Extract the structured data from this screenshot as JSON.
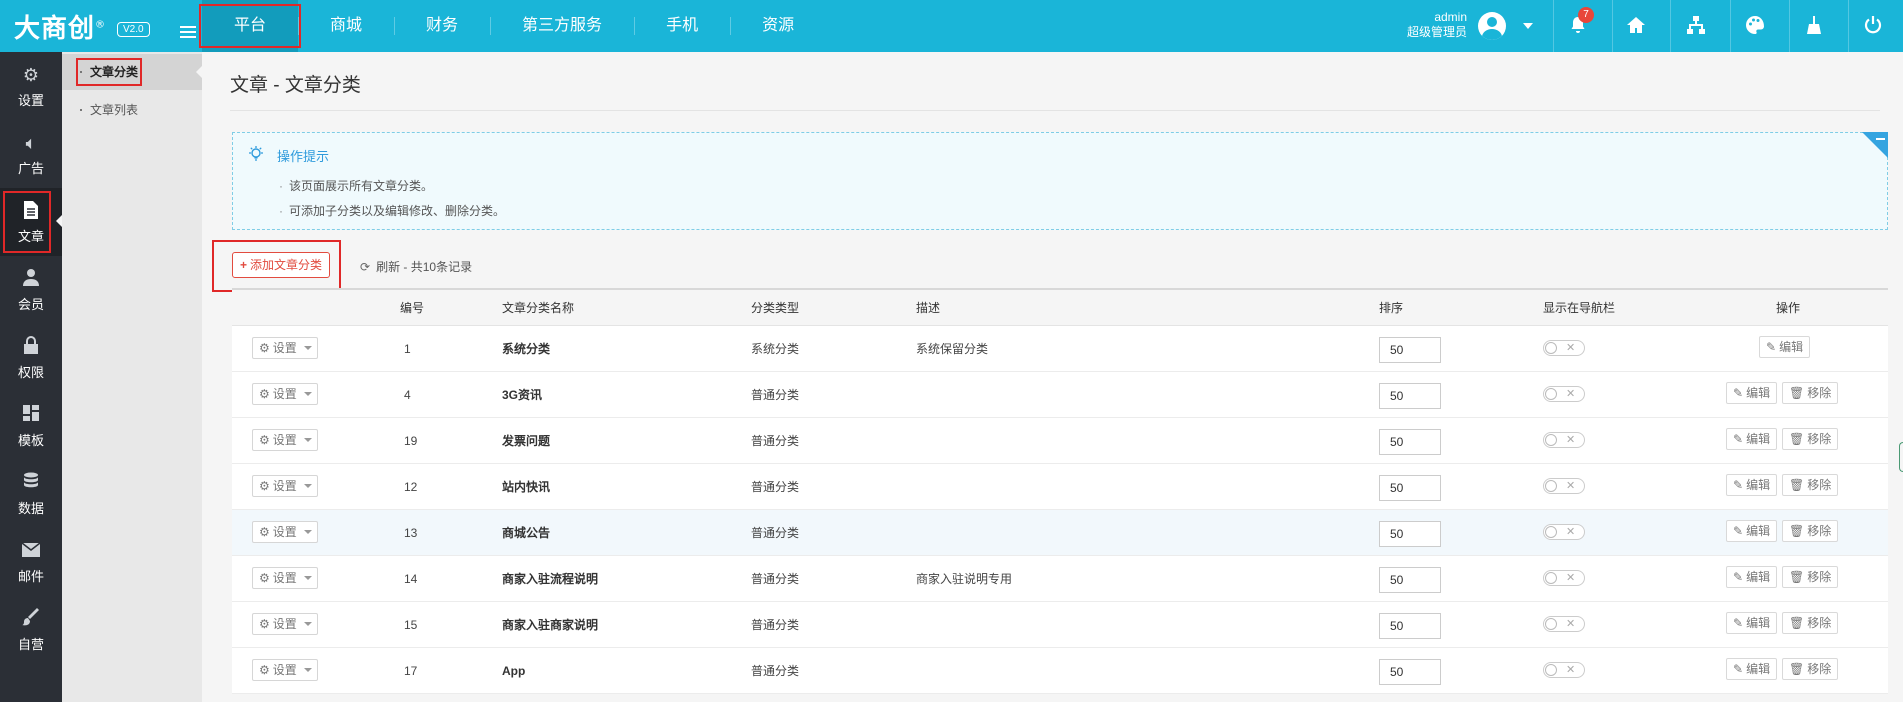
{
  "app": {
    "logo_text": "大商创",
    "logo_mark": "®",
    "version": "V2.0"
  },
  "topnav": [
    "平台",
    "商城",
    "财务",
    "第三方服务",
    "手机",
    "资源"
  ],
  "user": {
    "name": "admin",
    "role": "超级管理员"
  },
  "notifications": {
    "count": "7"
  },
  "sidebar": [
    {
      "label": "设置",
      "icon": "gear-icon"
    },
    {
      "label": "广告",
      "icon": "speaker-icon"
    },
    {
      "label": "文章",
      "icon": "document-icon"
    },
    {
      "label": "会员",
      "icon": "user-icon"
    },
    {
      "label": "权限",
      "icon": "lock-icon"
    },
    {
      "label": "模板",
      "icon": "grid-icon"
    },
    {
      "label": "数据",
      "icon": "database-icon"
    },
    {
      "label": "邮件",
      "icon": "mail-icon"
    },
    {
      "label": "自营",
      "icon": "brush-icon"
    }
  ],
  "subnav": [
    "文章分类",
    "文章列表"
  ],
  "page": {
    "title": "文章 - 文章分类"
  },
  "tips": {
    "title": "操作提示",
    "lines": [
      "该页面展示所有文章分类。",
      "可添加子分类以及编辑修改、删除分类。"
    ]
  },
  "toolbar": {
    "add_label": "添加文章分类",
    "refresh_label": "刷新 - 共10条记录"
  },
  "table": {
    "headers": {
      "id": "编号",
      "name": "文章分类名称",
      "type": "分类类型",
      "desc": "描述",
      "sort": "排序",
      "nav": "显示在导航栏",
      "ops": "操作"
    },
    "settings_label": "设置",
    "edit_label": "编辑",
    "remove_label": "移除",
    "rows": [
      {
        "id": "1",
        "name": "系统分类",
        "type": "系统分类",
        "desc": "系统保留分类",
        "sort": "50",
        "removable": false
      },
      {
        "id": "4",
        "name": "3G资讯",
        "type": "普通分类",
        "desc": "",
        "sort": "50",
        "removable": true
      },
      {
        "id": "19",
        "name": "发票问题",
        "type": "普通分类",
        "desc": "",
        "sort": "50",
        "removable": true
      },
      {
        "id": "12",
        "name": "站内快讯",
        "type": "普通分类",
        "desc": "",
        "sort": "50",
        "removable": true
      },
      {
        "id": "13",
        "name": "商城公告",
        "type": "普通分类",
        "desc": "",
        "sort": "50",
        "removable": true
      },
      {
        "id": "14",
        "name": "商家入驻流程说明",
        "type": "普通分类",
        "desc": "商家入驻说明专用",
        "sort": "50",
        "removable": true
      },
      {
        "id": "15",
        "name": "商家入驻商家说明",
        "type": "普通分类",
        "desc": "",
        "sort": "50",
        "removable": true
      },
      {
        "id": "17",
        "name": "App",
        "type": "普通分类",
        "desc": "",
        "sort": "50",
        "removable": true
      }
    ]
  },
  "colors": {
    "topbar": "#1ab5d8",
    "sidebar": "#2b2f36",
    "highlight": "#e02828",
    "accent": "#2f9bdc"
  }
}
